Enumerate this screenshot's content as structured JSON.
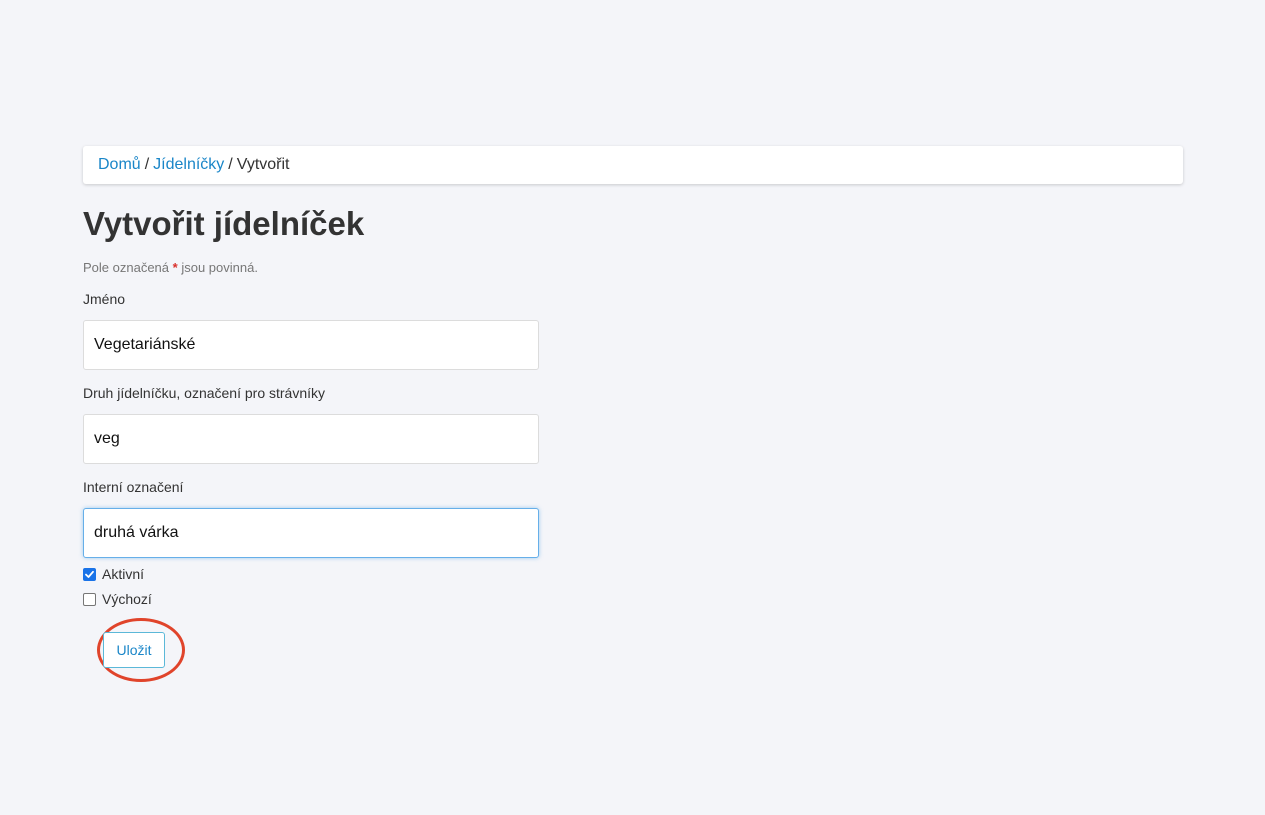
{
  "breadcrumb": {
    "home": "Domů",
    "menus": "Jídelníčky",
    "current": "Vytvořit",
    "separator": "/"
  },
  "page_title": "Vytvořit jídelníček",
  "required_hint": {
    "before": "Pole označená",
    "marker": "*",
    "after": "jsou povinná."
  },
  "form": {
    "name": {
      "label": "Jméno",
      "value": "Vegetariánské"
    },
    "type": {
      "label": "Druh jídelníčku, označení pro strávníky",
      "value": "veg"
    },
    "internal": {
      "label": "Interní označení",
      "value": "druhá várka"
    },
    "active": {
      "label": "Aktivní",
      "checked": true
    },
    "default": {
      "label": "Výchozí",
      "checked": false
    },
    "save_label": "Uložit"
  },
  "colors": {
    "background": "#f4f5f9",
    "link": "#1a86c8",
    "required": "#d9302b",
    "highlight_ring": "#e0442b",
    "checkbox_checked": "#1a73e8"
  }
}
